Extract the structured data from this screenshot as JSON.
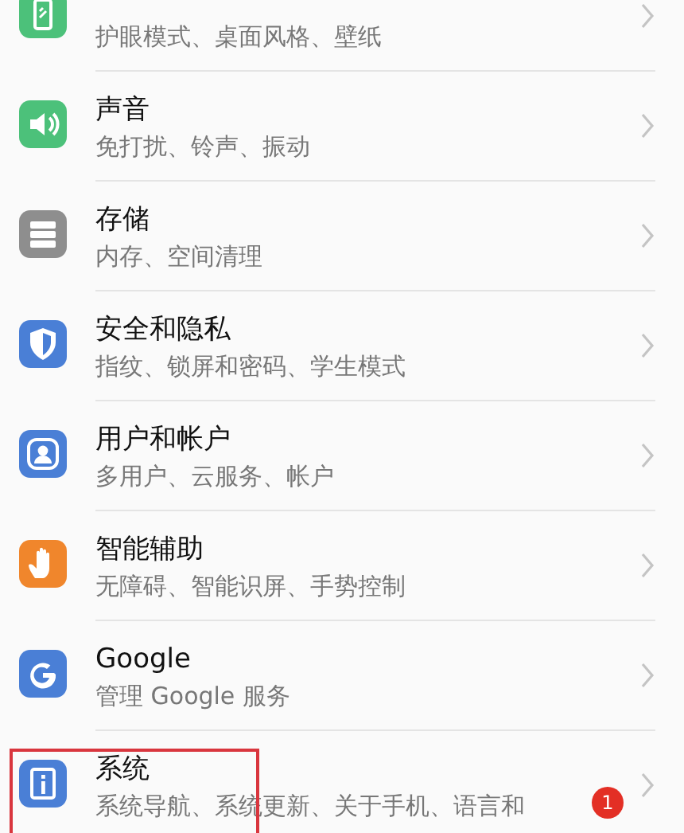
{
  "settings": [
    {
      "subtitle": "护眼模式、桌面风格、壁纸",
      "color": "#4cc17a"
    },
    {
      "title": "声音",
      "subtitle": "免打扰、铃声、振动",
      "color": "#4cc17a"
    },
    {
      "title": "存储",
      "subtitle": "内存、空间清理",
      "color": "#8e8e8e"
    },
    {
      "title": "安全和隐私",
      "subtitle": "指纹、锁屏和密码、学生模式",
      "color": "#4a7fd6"
    },
    {
      "title": "用户和帐户",
      "subtitle": "多用户、云服务、帐户",
      "color": "#4a7fd6"
    },
    {
      "title": "智能辅助",
      "subtitle": "无障碍、智能识屏、手势控制",
      "color": "#f0862c"
    },
    {
      "title": "Google",
      "subtitle": "管理 Google 服务",
      "color": "#4a7fd6"
    },
    {
      "title": "系统",
      "subtitle": "系统导航、系统更新、关于手机、语言和",
      "color": "#4a7fd6",
      "badge": "1",
      "highlighted": true
    }
  ]
}
